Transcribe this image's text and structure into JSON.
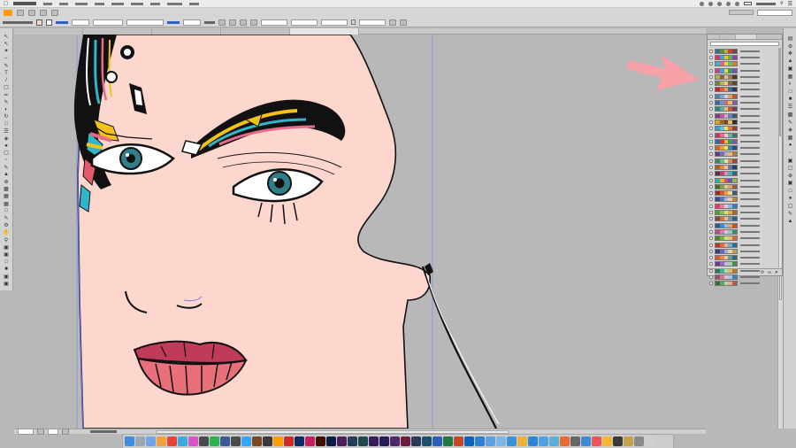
{
  "icons": {
    "apple": "apple-icon",
    "wifi": "wifi-icon",
    "battery": "battery-icon",
    "search": "search-icon",
    "trash": "trash-icon"
  },
  "dock_apps": [
    {
      "icon": "finder-icon",
      "color": "#3e8be2"
    },
    {
      "icon": "launchpad-icon",
      "color": "#9aa7b5"
    },
    {
      "icon": "mail-icon",
      "color": "#6fa6e8"
    },
    {
      "icon": "photos-icon",
      "color": "#f2a13a"
    },
    {
      "icon": "chrome-icon",
      "color": "#e4433a"
    },
    {
      "icon": "safari-icon",
      "color": "#3ea8e6"
    },
    {
      "icon": "itunes-icon",
      "color": "#d954c4"
    },
    {
      "icon": "app-icon",
      "color": "#4a4a4a"
    },
    {
      "icon": "spotify-icon",
      "color": "#2bb24c"
    },
    {
      "icon": "app-icon",
      "color": "#3b5998"
    },
    {
      "icon": "app-icon",
      "color": "#4b4b4b"
    },
    {
      "icon": "photoshop-icon",
      "color": "#31a8ff"
    },
    {
      "icon": "bridge-icon",
      "color": "#7a4b1e"
    },
    {
      "icon": "app-icon",
      "color": "#3a3a3a"
    },
    {
      "icon": "illustrator-icon",
      "color": "#ff9a00"
    },
    {
      "icon": "acrobat-icon",
      "color": "#d22b27"
    },
    {
      "icon": "photoshop-icon",
      "color": "#0d2a66"
    },
    {
      "icon": "indesign-icon",
      "color": "#c51f62"
    },
    {
      "icon": "illustrator-icon",
      "color": "#3d1300"
    },
    {
      "icon": "photoshop-icon",
      "color": "#0b1b4a"
    },
    {
      "icon": "muse-icon",
      "color": "#4e1e5e"
    },
    {
      "icon": "lightroom-icon",
      "color": "#253c5a"
    },
    {
      "icon": "audition-icon",
      "color": "#1e4a4a"
    },
    {
      "icon": "premiere-icon",
      "color": "#3b1b5a"
    },
    {
      "icon": "aftereffects-icon",
      "color": "#2a1a5a"
    },
    {
      "icon": "app-icon",
      "color": "#4c2a6a"
    },
    {
      "icon": "app-icon",
      "color": "#6c1e3e"
    },
    {
      "icon": "app-icon",
      "color": "#2a3a5a"
    },
    {
      "icon": "app-icon",
      "color": "#1e4e6e"
    },
    {
      "icon": "word-icon",
      "color": "#2b5eb8"
    },
    {
      "icon": "excel-icon",
      "color": "#1f7a40"
    },
    {
      "icon": "powerpoint-icon",
      "color": "#c7472b"
    },
    {
      "icon": "outlook-icon",
      "color": "#0b66c2"
    },
    {
      "icon": "app-icon",
      "color": "#2d7fd1"
    },
    {
      "icon": "app-icon",
      "color": "#5ea0e0"
    },
    {
      "icon": "app-icon",
      "color": "#7fb5e8"
    },
    {
      "icon": "app-icon",
      "color": "#3a93d8"
    },
    {
      "icon": "app-icon",
      "color": "#f0b030"
    },
    {
      "icon": "app-icon",
      "color": "#2f84d6"
    },
    {
      "icon": "app-icon",
      "color": "#4fa1e3"
    },
    {
      "icon": "app-icon",
      "color": "#57b0d8"
    },
    {
      "icon": "app-icon",
      "color": "#e86a2e"
    },
    {
      "icon": "app-icon",
      "color": "#666666"
    },
    {
      "icon": "app-icon",
      "color": "#3c8ad8"
    },
    {
      "icon": "app-icon",
      "color": "#ee5555"
    },
    {
      "icon": "app-icon",
      "color": "#f5b532"
    },
    {
      "icon": "app-icon",
      "color": "#3a3a3a"
    },
    {
      "icon": "app-icon",
      "color": "#c8a24a"
    },
    {
      "icon": "app-icon",
      "color": "#8a8a8a"
    },
    {
      "icon": "trash-icon",
      "color": "#cfcfcf"
    }
  ],
  "themes": [
    [
      "#3c6e9a",
      "#5b8f3a",
      "#c8a54a",
      "#b34d2e",
      "#7a3e5e"
    ],
    [
      "#e22a6f",
      "#3aa3d8",
      "#f2c21b",
      "#62b24a",
      "#8a3fb0"
    ],
    [
      "#2fb6c9",
      "#f05a9a",
      "#f7d23c",
      "#5ac86a",
      "#e07a2e"
    ],
    [
      "#d63a8a",
      "#31b0e0",
      "#ffd23c",
      "#2ea35a",
      "#7b4bc0"
    ],
    [
      "#c9a25a",
      "#7e6a3a",
      "#d8c08a",
      "#9a7a4a",
      "#4e3a2a"
    ],
    [
      "#6a8a3a",
      "#c0b05a",
      "#e2d08a",
      "#8a6a3a",
      "#5a4a2a"
    ],
    [
      "#b0283a",
      "#e05a4a",
      "#f2a23a",
      "#3a6aa0",
      "#2a3a5a"
    ],
    [
      "#5a7ab0",
      "#8aa0c8",
      "#c8d0e0",
      "#e8a05a",
      "#b05a3a"
    ],
    [
      "#3a6a9a",
      "#6a9ac8",
      "#e05a8a",
      "#f2c25a",
      "#8a5ab0"
    ],
    [
      "#2a8a7a",
      "#5ab0a0",
      "#e2c26a",
      "#c05a3a",
      "#7a3a5a"
    ],
    [
      "#8a3a7a",
      "#c05aa0",
      "#e8a0c8",
      "#5a8ab0",
      "#3a5a7a"
    ],
    [
      "#d8a030",
      "#a06a20",
      "#6a4a20",
      "#e0c070",
      "#3a3020"
    ],
    [
      "#3aa0c0",
      "#6ac0d8",
      "#f0e06a",
      "#e07a3a",
      "#a03a3a"
    ],
    [
      "#c03a5a",
      "#e86a8a",
      "#f8c0d0",
      "#6ab0a0",
      "#3a7a6a"
    ],
    [
      "#2a6ab0",
      "#e0303a",
      "#f0c020",
      "#30a050",
      "#8a50b0"
    ],
    [
      "#e05a2a",
      "#f0a030",
      "#f8d860",
      "#3a8ab0",
      "#2a4a7a"
    ],
    [
      "#5a3a8a",
      "#8a6ac0",
      "#c0a8e0",
      "#e8c06a",
      "#b07a3a"
    ],
    [
      "#3a8a5a",
      "#6ac08a",
      "#d8e8a0",
      "#e08a5a",
      "#a04a3a"
    ],
    [
      "#b05a2a",
      "#e08a4a",
      "#f8c08a",
      "#5a7ab0",
      "#2a3a6a"
    ],
    [
      "#6a2a4a",
      "#b04a7a",
      "#e88ab0",
      "#4ab0c0",
      "#2a6a7a"
    ],
    [
      "#2ab0a0",
      "#f0b030",
      "#e04a6a",
      "#5a5ac0",
      "#8ac04a"
    ],
    [
      "#4a6a2a",
      "#8aa04a",
      "#c8d08a",
      "#e0a06a",
      "#a05a3a"
    ],
    [
      "#a02a2a",
      "#d85a3a",
      "#f0a04a",
      "#f8d88a",
      "#3a5a8a"
    ],
    [
      "#3a4a8a",
      "#5a7ac0",
      "#a0b8e0",
      "#e8c8a0",
      "#c0804a"
    ],
    [
      "#e03a6a",
      "#f07aa0",
      "#f8c0d8",
      "#7ac0e0",
      "#3a7ab0"
    ],
    [
      "#5aa02a",
      "#8ac04a",
      "#d0e08a",
      "#e0b04a",
      "#a06a2a"
    ],
    [
      "#8a4a2a",
      "#c07a4a",
      "#e8b88a",
      "#6a9ab0",
      "#3a5a7a"
    ],
    [
      "#2a5a8a",
      "#4a8ac0",
      "#8ac0e8",
      "#e8a06a",
      "#b05a2a"
    ],
    [
      "#c04a8a",
      "#e07ab0",
      "#f8b8d8",
      "#8ad0c0",
      "#3a8a7a"
    ],
    [
      "#4a8a2a",
      "#7ab04a",
      "#c8e08a",
      "#f0c06a",
      "#c0703a"
    ],
    [
      "#b03a2a",
      "#e06a4a",
      "#f8a88a",
      "#6ab0d0",
      "#2a6a9a"
    ],
    [
      "#3a3a7a",
      "#6a6ab0",
      "#a8a8e0",
      "#e8d0a0",
      "#c09a5a"
    ],
    [
      "#d85a2a",
      "#f08a4a",
      "#f8c08a",
      "#5aa0a0",
      "#2a6a6a"
    ],
    [
      "#6a3a8a",
      "#9a6ac0",
      "#d0b0e8",
      "#a0d8a0",
      "#4a8a4a"
    ],
    [
      "#2a7a5a",
      "#4ab08a",
      "#a0e0c0",
      "#e8b86a",
      "#b07a3a"
    ],
    [
      "#a04a6a",
      "#d07a9a",
      "#f0b8cc",
      "#a0c8e8",
      "#4a7ab0"
    ],
    [
      "#3a6a3a",
      "#6aa06a",
      "#b0d8b0",
      "#e8a88a",
      "#b05a4a"
    ]
  ]
}
